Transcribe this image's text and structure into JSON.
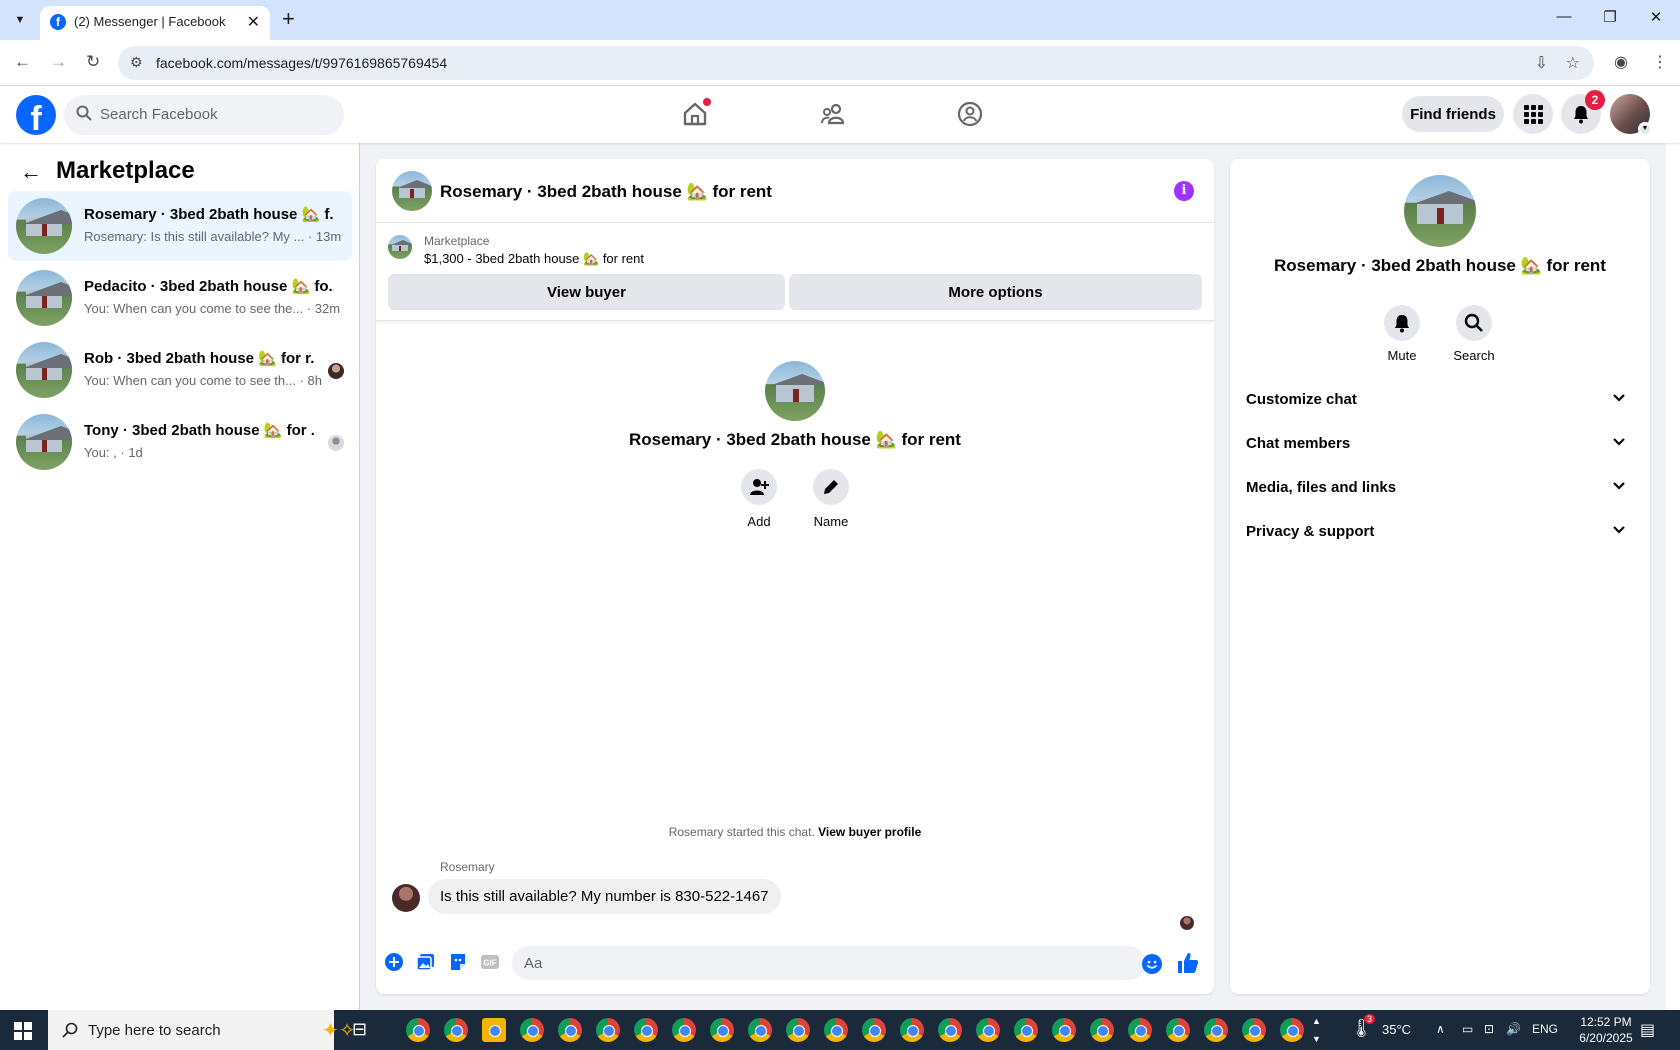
{
  "browser": {
    "tab_title": "(2) Messenger | Facebook",
    "url": "facebook.com/messages/t/9976169865769454"
  },
  "header": {
    "search_placeholder": "Search Facebook",
    "find_friends_label": "Find friends",
    "notification_count": "2",
    "brand_color": "#0866ff"
  },
  "sidebar": {
    "title": "Marketplace",
    "conversations": [
      {
        "name": "Rosemary · 3bed 2bath house 🏡 f...",
        "preview": "Rosemary: Is this still available? My ... · 13m"
      },
      {
        "name": "Pedacito · 3bed 2bath house 🏡 fo...",
        "preview": "You: When can you come to see the... · 32m"
      },
      {
        "name": "Rob · 3bed 2bath house 🏡 for r...",
        "preview": "You: When can you come to see th... · 8h"
      },
      {
        "name": "Tony · 3bed 2bath house 🏡 for ...",
        "preview": "You: , · 1d"
      }
    ]
  },
  "chat": {
    "title": "Rosemary · 3bed 2bath house 🏡 for rent",
    "listing_source": "Marketplace",
    "listing_summary": "$1,300 - 3bed 2bath house 🏡 for rent",
    "view_buyer_label": "View buyer",
    "more_options_label": "More options",
    "intro_name": "Rosemary · 3bed 2bath house 🏡 for rent",
    "add_label": "Add",
    "name_label": "Name",
    "started_text": "Rosemary started this chat.",
    "view_buyer_profile": "View buyer profile",
    "sender": "Rosemary",
    "message": "Is this still available? My number is 830-522-1467",
    "composer_placeholder": "Aa"
  },
  "details": {
    "name": "Rosemary · 3bed 2bath house 🏡 for rent",
    "mute_label": "Mute",
    "search_label": "Search",
    "sections": [
      "Customize chat",
      "Chat members",
      "Media, files and links",
      "Privacy & support"
    ]
  },
  "taskbar": {
    "search_placeholder": "Type here to search",
    "weather_badge": "3",
    "temperature": "35°C",
    "language": "ENG",
    "time": "12:52 PM",
    "date": "6/20/2025"
  }
}
